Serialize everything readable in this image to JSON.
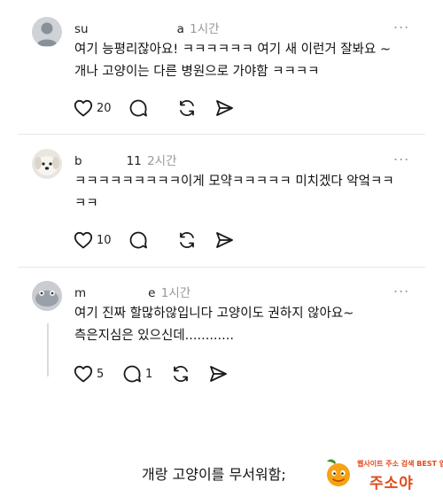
{
  "posts": [
    {
      "user": "su",
      "user_end": "a",
      "time": "1시간",
      "more": "...",
      "text": "여기 능평리잖아요! ㅋㅋㅋㅋㅋㅋ 여기 새 이런거 잘봐요 ~\n개나 고양이는 다른 병원으로 가야함 ㅋㅋㅋㅋ",
      "likes": "20",
      "replies": ""
    },
    {
      "user": "b",
      "user_end": "11",
      "time": "2시간",
      "more": "...",
      "text": "ㅋㅋㅋㅋㅋㅋㅋㅋㅋ이게 모약ㅋㅋㅋㅋㅋ 미치겠다 악엌ㅋㅋ\nㅋㅋ",
      "likes": "10",
      "replies": ""
    },
    {
      "user": "m",
      "user_end": "e",
      "time": "1시간",
      "more": "...",
      "text": "여기 진짜 할많하않입니다 고양이도 권하지 않아요~\n측은지심은 있으신데............",
      "likes": "5",
      "replies": "1"
    }
  ],
  "caption": "개랑 고양이를 무서워함;",
  "logo": {
    "tagline": "웹사이트 주소 검색 BEST 업체",
    "brand": "주소야",
    "icon": "orange-mascot-icon"
  },
  "icons": {
    "like": "heart-icon",
    "reply": "comment-icon",
    "repost": "repost-icon",
    "share": "send-icon"
  },
  "colors": {
    "text": "#111111",
    "muted": "#999999",
    "icon": "#1a1a1a",
    "brand": "#e34a1b"
  }
}
